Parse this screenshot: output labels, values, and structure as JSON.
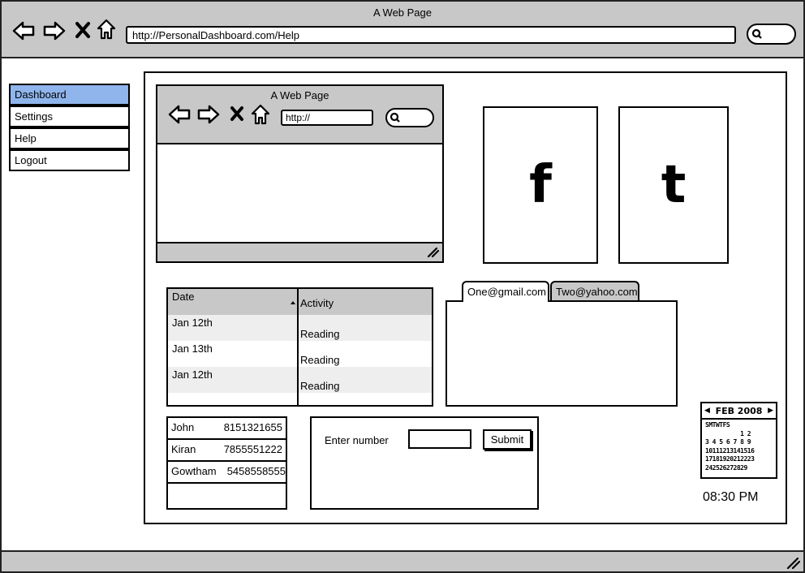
{
  "browser": {
    "title": "A Web Page",
    "url": "http://PersonalDashboard.com/Help"
  },
  "sidebar": {
    "items": [
      {
        "label": "Dashboard"
      },
      {
        "label": "Settings"
      },
      {
        "label": "Help"
      },
      {
        "label": "Logout"
      }
    ]
  },
  "inner_browser": {
    "title": "A Web Page",
    "url": "http://"
  },
  "social": {
    "facebook": "f",
    "tumblr": "t"
  },
  "activity_table": {
    "headers": [
      "Date",
      "Activity"
    ],
    "rows": [
      {
        "date": "Jan 12th",
        "activity": "Reading"
      },
      {
        "date": "Jan 13th",
        "activity": "Reading"
      },
      {
        "date": "Jan 12th",
        "activity": "Reading"
      }
    ]
  },
  "mail_tabs": [
    "One@gmail.com",
    "Two@yahoo.com"
  ],
  "contacts": [
    {
      "name": "John",
      "phone": "8151321655"
    },
    {
      "name": "Kiran",
      "phone": "7855551222"
    },
    {
      "name": "Gowtham",
      "phone": "5458558555"
    }
  ],
  "entry_form": {
    "label": "Enter number",
    "input_value": "",
    "submit_label": "Submit"
  },
  "calendar": {
    "month": "FEB 2008",
    "day_headers": "SMTWTFS",
    "rows": [
      "          1 2",
      "3 4 5 6 7 8 9",
      "10111213141516",
      "17181920212223",
      "242526272829"
    ]
  },
  "clock": "08:30 PM",
  "colors": {
    "chrome": "#c8c8c8",
    "active_nav": "#8fb5ec",
    "table_header": "#c8c8c8",
    "row_stripe": "#eeeeee"
  }
}
